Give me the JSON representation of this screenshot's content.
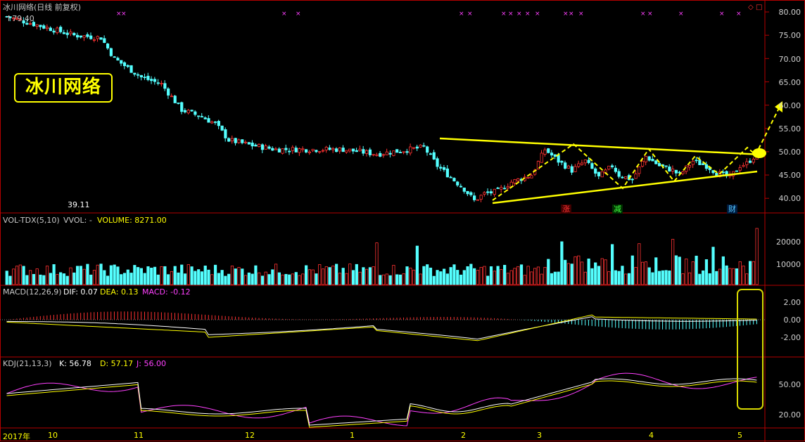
{
  "title": "冰川网络(日线 前复权)",
  "stamp_text": "冰川网络",
  "top_price_label": "79.40",
  "low_label": "39.11",
  "price_axis": [
    "80.00",
    "75.00",
    "70.00",
    "65.00",
    "60.00",
    "55.00",
    "50.00",
    "45.00",
    "40.00"
  ],
  "vol": {
    "name": "VOL-TDX(5,10)",
    "vvol": "VVOL: -",
    "volume_label": "VOLUME: 8271.00",
    "axis": [
      "20000",
      "10000"
    ]
  },
  "macd": {
    "name": "MACD(12,26,9)",
    "dif": "DIF: 0.07",
    "dea": "DEA: 0.13",
    "macd": "MACD: -0.12",
    "axis": [
      "2.00",
      "0.00",
      "-2.00"
    ]
  },
  "kdj": {
    "name": "KDJ(21,13,3)",
    "k": "K: 56.78",
    "d": "D: 57.17",
    "j": "J: 56.00",
    "axis": [
      "50.00",
      "20.00"
    ]
  },
  "events": {
    "up": "涨",
    "down": "减",
    "fin": "财"
  },
  "x_axis": [
    "2017年",
    "10",
    "11",
    "12",
    "1",
    "2",
    "3",
    "4",
    "5"
  ],
  "colors": {
    "up": "#ff3232",
    "down": "#54ffff",
    "trend": "#ffff00",
    "kdj_j": "#ff40ff",
    "grid": "#8b0000"
  }
}
